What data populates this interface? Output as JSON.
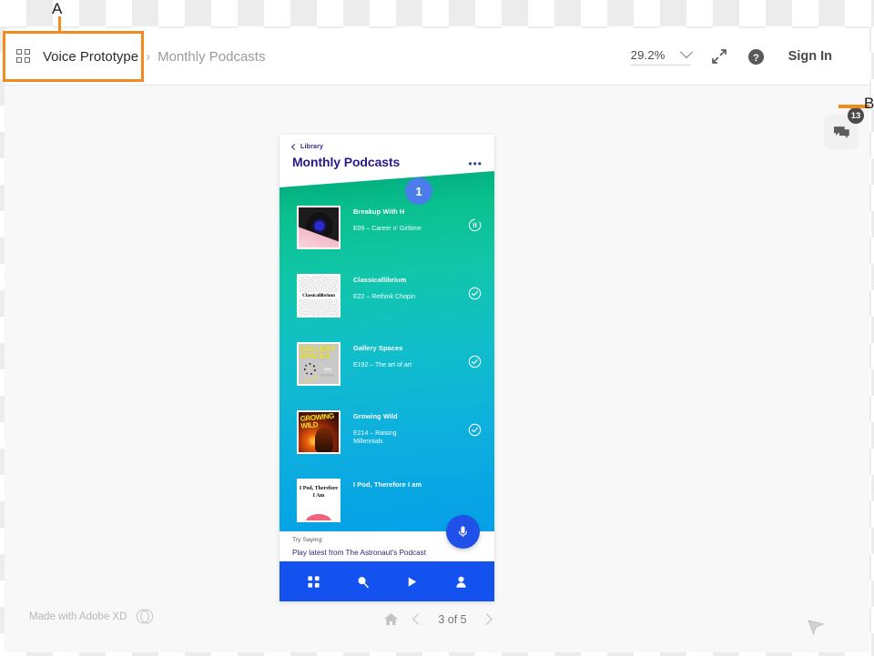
{
  "toolbar": {
    "grid_icon": "grid-icon",
    "project_name": "Voice Prototype",
    "separator": "›",
    "page_name": "Monthly Podcasts",
    "zoom_value": "29.2%",
    "chevron_icon": "chevron-down-icon",
    "expand_icon": "expand-arrows-icon",
    "help_icon": "help-circle-icon",
    "sign_in_label": "Sign In"
  },
  "artboard": {
    "back_label": "Library",
    "title": "Monthly Podcasts",
    "overflow_icon": "•••",
    "badge_number": "1",
    "items": [
      {
        "name": "Breakup With H",
        "episode": "E09 – Career n' Girltime",
        "status_icon": "pause-circle-icon",
        "art": "vinyl-record"
      },
      {
        "name": "Classicallibrium",
        "episode": "E22 – Rethink Chopin",
        "status_icon": "check-circle-icon",
        "art": "classicallibrium-cover",
        "art_text": "Classicallibrium"
      },
      {
        "name": "Gallery Spaces",
        "episode": "E192 – The art of art",
        "status_icon": "check-circle-icon",
        "art": "gallery-spaces-cover",
        "art_text": "GALLERY SPACES"
      },
      {
        "name": "Growing Wild",
        "episode": "E214 – Raising Millennials",
        "status_icon": "check-circle-icon",
        "art": "growing-wild-cover",
        "art_text": "GROWING WILD"
      },
      {
        "name": "I Pod, Therefore I am",
        "episode": "",
        "status_icon": "",
        "art": "ipod-cover",
        "art_text": "I Pod, Therefore I Am"
      }
    ],
    "mic_icon": "microphone-icon",
    "try_saying_label": "Try Saying:",
    "try_saying_phrase": "Play latest from The Astronaut's Podcast",
    "nav": [
      {
        "icon": "grid-apps-icon"
      },
      {
        "icon": "search-icon"
      },
      {
        "icon": "play-icon"
      },
      {
        "icon": "profile-icon"
      }
    ]
  },
  "footer": {
    "made_with_label": "Made with Adobe XD",
    "cc_logo_icon": "creative-cloud-icon",
    "home_icon": "home-icon",
    "prev_icon": "chevron-left-icon",
    "page_label": "3 of 5",
    "next_icon": "chevron-right-icon"
  },
  "comments": {
    "chat_icon": "chat-bubbles-icon",
    "count": "13"
  },
  "annotations": {
    "a_label": "A",
    "b_label": "B",
    "highlight_color": "#f28b1e"
  },
  "cursor": {
    "icon": "cursor-arrow-icon"
  }
}
